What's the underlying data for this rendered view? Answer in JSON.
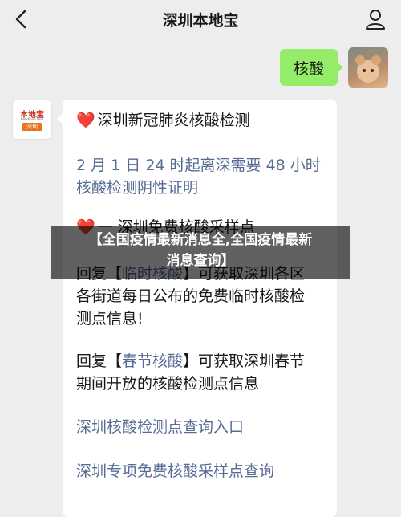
{
  "header": {
    "title": "深圳本地宝",
    "back_icon": "chevron-left-icon",
    "profile_icon": "person-icon"
  },
  "outgoing": {
    "text": "核酸"
  },
  "bot": {
    "avatar": {
      "line1": "本地宝",
      "line2": "Bendibao.com",
      "line3": "深圳"
    },
    "heading_icon": "❤️",
    "heading": "深圳新冠肺炎核酸检测",
    "notice_line1": "2 月 1 日 24 时起离深需要 48 小时",
    "notice_line2": "核酸检测阴性证明",
    "section_icon": "❤️",
    "section_title": "一    深圳免费核酸采样点",
    "reply1_pre": "回复【",
    "reply1_keyword": "临时核酸",
    "reply1_post": "】可获取深圳各区",
    "reply1_line2": "各街道每日公布的免费临时核酸检",
    "reply1_line3": "测点信息!",
    "reply2_pre": "回复【",
    "reply2_keyword": "春节核酸",
    "reply2_post": "】可获取深圳春节",
    "reply2_line2": "期间开放的核酸检测点信息",
    "link1": "深圳核酸检测点查询入口",
    "link2": "深圳专项免费核酸采样点查询"
  },
  "overlay": {
    "line1": "【全国疫情最新消息全,全国疫情最新",
    "line2": "消息查询】"
  }
}
